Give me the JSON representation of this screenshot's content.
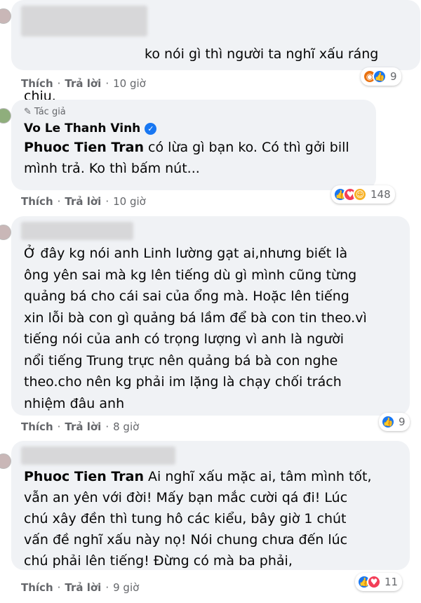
{
  "comments": [
    {
      "text_lines": [
        "ko nói gì thì người ta nghĩ xấu ráng",
        "chịu."
      ],
      "actions": {
        "like": "Thích",
        "reply": "Trả lời",
        "time": "10 giờ"
      },
      "reactions": {
        "icons": [
          "angry",
          "like"
        ],
        "count": "9"
      }
    },
    {
      "author_label": "Tác giả",
      "author_name": "Vo Le Thanh Vinh",
      "mention": "Phuoc Tien Tran",
      "text_first": " có lừa gì bạn ko. Có thì gởi bill",
      "text_rest": "mình trả. Ko thì bấm nút...",
      "actions": {
        "like": "Thích",
        "reply": "Trả lời",
        "time": "10 giờ"
      },
      "reactions": {
        "icons": [
          "like",
          "love",
          "care"
        ],
        "count": "148"
      }
    },
    {
      "text": "Ở đây kg nói anh Linh lường gạt ai,nhưng biết là\nông yên sai mà kg lên tiếng dù gì mình cũng từng\nquảng bá cho cái sai của ổng mà. Hoặc lên tiếng\nxin lỗi bà con gì quảng bá lầm để bà con tin theo.vì\ntiếng nói của anh có trọng lượng vì anh là người\nnổi tiếng Trung trực nên quảng bá bà con nghe\ntheo.cho nên kg phải im lặng là chạy chối trách\nnhiệm đâu anh",
      "actions": {
        "like": "Thích",
        "reply": "Trả lời",
        "time": "8 giờ"
      },
      "reactions": {
        "icons": [
          "like"
        ],
        "count": "9"
      }
    },
    {
      "mention": "Phuoc Tien Tran",
      "text_first": " Ai nghĩ xấu mặc ai, tâm mình tốt,",
      "text_rest": "vẫn an yên với đời! Mấy bạn mắc cười qá đi! Lúc\nchú xây đền thì tung hô các kiểu, bây giờ 1 chút\nvấn đề nghĩ xấu này nọ! Nói chung chưa đến lúc\nchú phải lên tiếng! Đừng có mà ba phải,",
      "actions": {
        "like": "Thích",
        "reply": "Trả lời",
        "time": "9 giờ"
      },
      "reactions": {
        "icons": [
          "like",
          "love"
        ],
        "count": "11"
      }
    }
  ],
  "colors": {
    "bubble": "#f0f2f5",
    "like": "#1877f2",
    "love": "#f33e58",
    "meta": "#65676b"
  }
}
